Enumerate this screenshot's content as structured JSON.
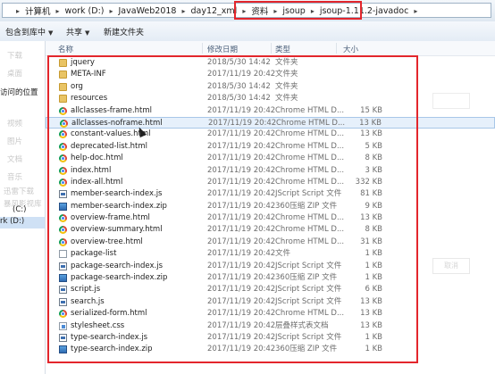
{
  "address_bar": {
    "crumbs": [
      "计算机",
      "work (D:)",
      "JavaWeb2018",
      "day12_xml",
      "资料",
      "jsoup",
      "jsoup-1.11.2-javadoc"
    ]
  },
  "toolbar": {
    "include_library": "包含到库中",
    "share": "共享",
    "new_folder": "新建文件夹"
  },
  "nav": {
    "recent_places": "访问的位置",
    "drive_c": "(C:)",
    "drive_d": "rk (D:)",
    "faded": [
      "下载",
      "桌面",
      "视频",
      "图片",
      "文档",
      "音乐",
      "迅雷下载",
      "暴风影视库"
    ]
  },
  "columns": {
    "name": "名称",
    "date": "修改日期",
    "type": "类型",
    "size": "大小"
  },
  "files": [
    {
      "name": "jquery",
      "date": "2018/5/30 14:42",
      "type": "文件夹",
      "size": "",
      "icon": "folder-icon"
    },
    {
      "name": "META-INF",
      "date": "2017/11/19 20:42",
      "type": "文件夹",
      "size": "",
      "icon": "folder-icon"
    },
    {
      "name": "org",
      "date": "2018/5/30 14:42",
      "type": "文件夹",
      "size": "",
      "icon": "folder-icon"
    },
    {
      "name": "resources",
      "date": "2018/5/30 14:42",
      "type": "文件夹",
      "size": "",
      "icon": "folder-icon"
    },
    {
      "name": "allclasses-frame.html",
      "date": "2017/11/19 20:42",
      "type": "Chrome HTML D...",
      "size": "15 KB",
      "icon": "chrome-icon"
    },
    {
      "name": "allclasses-noframe.html",
      "date": "2017/11/19 20:42",
      "type": "Chrome HTML D...",
      "size": "13 KB",
      "icon": "chrome-icon"
    },
    {
      "name": "constant-values.html",
      "date": "2017/11/19 20:42",
      "type": "Chrome HTML D...",
      "size": "13 KB",
      "icon": "chrome-icon"
    },
    {
      "name": "deprecated-list.html",
      "date": "2017/11/19 20:42",
      "type": "Chrome HTML D...",
      "size": "5 KB",
      "icon": "chrome-icon"
    },
    {
      "name": "help-doc.html",
      "date": "2017/11/19 20:42",
      "type": "Chrome HTML D...",
      "size": "8 KB",
      "icon": "chrome-icon"
    },
    {
      "name": "index.html",
      "date": "2017/11/19 20:42",
      "type": "Chrome HTML D...",
      "size": "3 KB",
      "icon": "chrome-icon"
    },
    {
      "name": "index-all.html",
      "date": "2017/11/19 20:42",
      "type": "Chrome HTML D...",
      "size": "332 KB",
      "icon": "chrome-icon"
    },
    {
      "name": "member-search-index.js",
      "date": "2017/11/19 20:42",
      "type": "JScript Script 文件",
      "size": "81 KB",
      "icon": "js-icon"
    },
    {
      "name": "member-search-index.zip",
      "date": "2017/11/19 20:42",
      "type": "360压缩 ZIP 文件",
      "size": "9 KB",
      "icon": "zip-icon"
    },
    {
      "name": "overview-frame.html",
      "date": "2017/11/19 20:42",
      "type": "Chrome HTML D...",
      "size": "13 KB",
      "icon": "chrome-icon"
    },
    {
      "name": "overview-summary.html",
      "date": "2017/11/19 20:42",
      "type": "Chrome HTML D...",
      "size": "8 KB",
      "icon": "chrome-icon"
    },
    {
      "name": "overview-tree.html",
      "date": "2017/11/19 20:42",
      "type": "Chrome HTML D...",
      "size": "31 KB",
      "icon": "chrome-icon"
    },
    {
      "name": "package-list",
      "date": "2017/11/19 20:42",
      "type": "文件",
      "size": "1 KB",
      "icon": "file-icon"
    },
    {
      "name": "package-search-index.js",
      "date": "2017/11/19 20:42",
      "type": "JScript Script 文件",
      "size": "1 KB",
      "icon": "js-icon"
    },
    {
      "name": "package-search-index.zip",
      "date": "2017/11/19 20:42",
      "type": "360压缩 ZIP 文件",
      "size": "1 KB",
      "icon": "zip-icon"
    },
    {
      "name": "script.js",
      "date": "2017/11/19 20:42",
      "type": "JScript Script 文件",
      "size": "6 KB",
      "icon": "js-icon"
    },
    {
      "name": "search.js",
      "date": "2017/11/19 20:42",
      "type": "JScript Script 文件",
      "size": "13 KB",
      "icon": "js-icon"
    },
    {
      "name": "serialized-form.html",
      "date": "2017/11/19 20:42",
      "type": "Chrome HTML D...",
      "size": "13 KB",
      "icon": "chrome-icon"
    },
    {
      "name": "stylesheet.css",
      "date": "2017/11/19 20:42",
      "type": "层叠样式表文档",
      "size": "13 KB",
      "icon": "css-icon"
    },
    {
      "name": "type-search-index.js",
      "date": "2017/11/19 20:42",
      "type": "JScript Script 文件",
      "size": "1 KB",
      "icon": "js-icon"
    },
    {
      "name": "type-search-index.zip",
      "date": "2017/11/19 20:42",
      "type": "360压缩 ZIP 文件",
      "size": "1 KB",
      "icon": "zip-icon"
    }
  ],
  "hovered_file": "allclasses-noframe.html",
  "ghost_button": "取消",
  "colors": {
    "highlight_box": "#e3262c",
    "folder": "#e9c464",
    "selection": "#cfe1f5"
  }
}
